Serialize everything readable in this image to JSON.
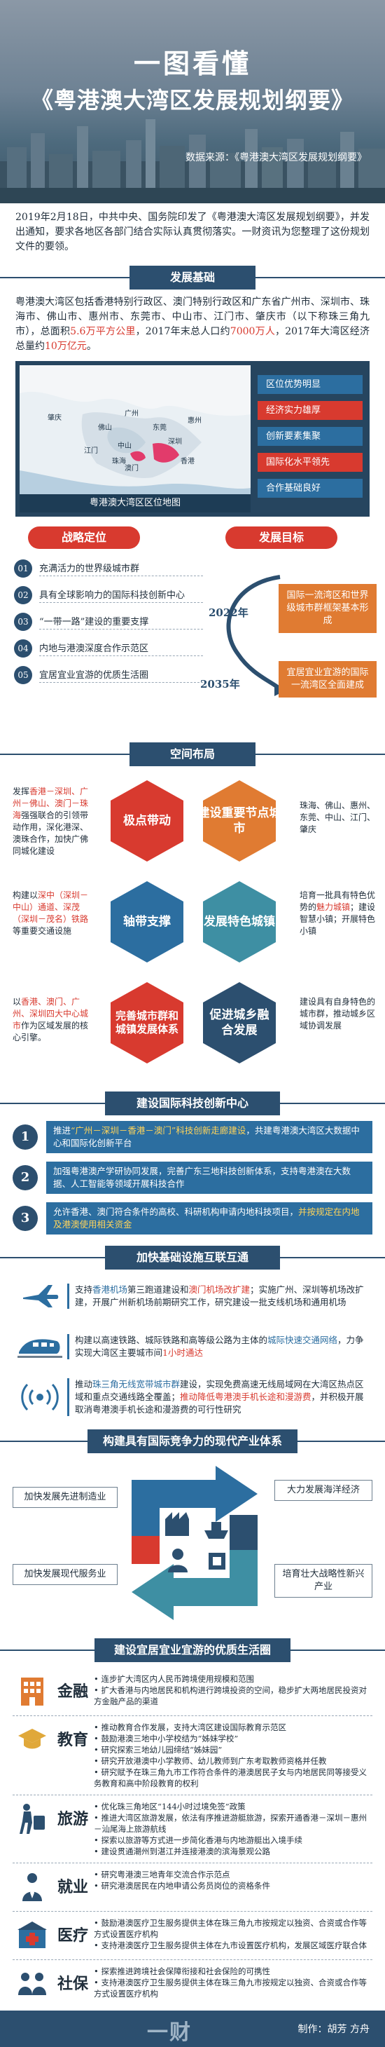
{
  "hero": {
    "kicker": "一图看懂",
    "title": "《粤港澳大湾区发展规划纲要》",
    "source": "数据来源：《粤港澳大湾区发展规划纲要》"
  },
  "intro": "2019年2月18日，中共中央、国务院印发了《粤港澳大湾区发展规划纲要》，并发出通知，要求各地区各部门结合实际认真贯彻落实。一财资讯为您整理了这份规划文件的要领。",
  "basics": {
    "header": "发展基础",
    "text_a": "粤港澳大湾区包括香港特别行政区、澳门特别行政区和广东省广州市、深圳市、珠海市、佛山市、惠州市、东莞市、中山市、江门市、肇庆市（以下称珠三角九市），总面积",
    "text_area": "5.6万平方公里",
    "text_b": "，2017年末总人口约",
    "text_pop": "7000万人",
    "text_c": "，2017年大湾区经济总量约",
    "text_gdp": "10万亿元",
    "text_d": "。",
    "map_caption": "粤港澳大湾区区位地图",
    "map_cities": [
      "广州",
      "佛山",
      "东莞",
      "惠州",
      "深圳",
      "香港",
      "澳门",
      "珠海",
      "中山",
      "江门",
      "肇庆"
    ],
    "advantages": [
      {
        "label": "区位优势明显",
        "color": "#2c6ea0"
      },
      {
        "label": "经济实力雄厚",
        "color": "#d83a2f"
      },
      {
        "label": "创新要素集聚",
        "color": "#2c6ea0"
      },
      {
        "label": "国际化水平领先",
        "color": "#d83a2f"
      },
      {
        "label": "合作基础良好",
        "color": "#2c6ea0"
      }
    ]
  },
  "positioning": {
    "header": "战略定位",
    "items": [
      {
        "num": "01",
        "text": "充满活力的世界级城市群"
      },
      {
        "num": "02",
        "text": "具有全球影响力的国际科技创新中心"
      },
      {
        "num": "03",
        "text": "“一带一路”建设的重要支撑"
      },
      {
        "num": "04",
        "text": "内地与港澳深度合作示范区"
      },
      {
        "num": "05",
        "text": "宜居宜业宜游的优质生活圈"
      }
    ]
  },
  "goals": {
    "header": "发展目标",
    "year_1": "2022年",
    "goal_1": "国际一流湾区和世界级城市群框架基本形成",
    "year_2": "2035年",
    "goal_2": "宜居宜业宜游的国际一流湾区全面建成"
  },
  "spatial": {
    "header": "空间布局",
    "hexes": [
      {
        "label": "极点带动",
        "color": "#d83a2f"
      },
      {
        "label": "建设重要节点城市",
        "color": "#e07b32"
      },
      {
        "label": "轴带支撑",
        "color": "#2c6ea0"
      },
      {
        "label": "发展特色城镇",
        "color": "#3e8fa3"
      },
      {
        "label": "完善城市群和城镇发展体系",
        "color": "#d83a2f"
      },
      {
        "label": "促进城乡融合发展",
        "color": "#2c4f6f"
      }
    ],
    "left_1_a": "发挥",
    "left_1_hl": "香港－深圳、广州－佛山、澳门－珠海",
    "left_1_b": "强强联合的引领带动作用，深化港深、澳珠合作，加快广佛同城化建设",
    "left_2_a": "构建以",
    "left_2_hl": "深中（深圳－中山）通道、深茂（深圳－茂名）铁路",
    "left_2_b": "等重要交通设施",
    "left_3_a": "以",
    "left_3_hl": "香港、澳门、广州、深圳四大中心城市",
    "left_3_b": "作为区域发展的核心引擎。",
    "right_1": "珠海、佛山、惠州、东莞、中山、江门、肇庆",
    "right_2_a": "培育一批具有特色优势的",
    "right_2_hl": "魅力城镇",
    "right_2_b": "；建设智慧小镇；开展特色小镇",
    "right_3": "建设具有自身特色的城市群，推动城乡区域协调发展"
  },
  "innovation": {
    "header": "建设国际科技创新中心",
    "rows": [
      {
        "num": "1",
        "a": "推进",
        "y": "“广州－深圳－香港－澳门”科技创新走廊建设",
        "b": "，共建粤港澳大湾区大数据中心和国际化创新平台"
      },
      {
        "num": "2",
        "a": "加强粤港澳产学研协同发展，完善广东三地科技创新体系，支持粤港澳在大数据、人工智能等领域开展科技合作",
        "y": "",
        "b": ""
      },
      {
        "num": "3",
        "a": "允许香港、澳门符合条件的高校、科研机构申请内地科技项目，",
        "y": "并按规定在内地及港澳使用相关资金",
        "b": ""
      }
    ]
  },
  "infrastructure": {
    "header": "加快基础设施互联互通",
    "rows": [
      {
        "icon": "airplane-icon",
        "a": "支持",
        "hl": "香港机场",
        "b": "第三跑道建设和",
        "rd": "澳门机场改扩建",
        "c": "；实施广州、深圳等机场改扩建，开展广州新机场前期研究工作，研究建设一批支线机场和通用机场"
      },
      {
        "icon": "train-icon",
        "a": "构建以高速铁路、城际铁路和高等级公路为主体的",
        "hl": "城际快速交通网络",
        "b": "，力争实现大湾区主要城市间",
        "rd": "1小时通达",
        "c": ""
      },
      {
        "icon": "signal-icon",
        "a": "推动",
        "hl": "珠三角无线宽带城市群",
        "b": "建设，实现免费高速无线局域网在大湾区热点区域和重点交通线路全覆盖；",
        "rd": "推动降低粤港澳手机长途和漫游费",
        "c": "，并积极开展取消粤港澳手机长途和漫游费的可行性研究"
      }
    ]
  },
  "industry": {
    "header": "构建具有国际竞争力的现代产业体系",
    "labels": [
      "加快发展先进制造业",
      "大力发展海洋经济",
      "加快发展现代服务业",
      "培育壮大战略性新兴产业"
    ]
  },
  "livable": {
    "header": "建设宜居宜业宜游的优质生活圈",
    "rows": [
      {
        "icon": "finance-icon",
        "cat": "金融",
        "items": [
          "连步扩大湾区内人民币跨境使用规模和范围",
          "扩大香港与内地居民和机构进行跨境投资的空间，稳步扩大两地居民投资对方金融产品的渠道"
        ]
      },
      {
        "icon": "education-icon",
        "cat": "教育",
        "items": [
          "推动教育合作发展，支持大湾区建设国际教育示范区",
          "鼓励港澳三地中小学校结为“姊妹学校”",
          "研究探索三地幼儿园缔结“姊妹园”",
          "研究开放港澳中小学教师、幼儿教师到广东考取教师资格并任教",
          "研究赋予在珠三角九市工作符合条件的港澳居民子女与内地居民同等接受义务教育和高中阶段教育的权利"
        ]
      },
      {
        "icon": "travel-icon",
        "cat": "旅游",
        "items": [
          "优化珠三角地区“144小时过境免签”政策",
          "推进大湾区旅游发展，依法有序推进游艇旅游，探索开通香港－深圳－惠州－汕尾海上旅游航线",
          "探索以旅游等方式进一步简化香港与内地游艇出入境手续",
          "建设贯通潮州到湛江并连接港澳的滨海景观公路"
        ]
      },
      {
        "icon": "employment-icon",
        "cat": "就业",
        "items": [
          "研究粤港澳三地青年交流合作示范点",
          "研究港澳居民在内地申请公务员岗位的资格条件"
        ]
      },
      {
        "icon": "medical-icon",
        "cat": "医疗",
        "items": [
          "鼓励港澳医疗卫生服务提供主体在珠三角九市按规定以独资、合资或合作等方式设置医疗机构",
          "支持港澳医疗卫生服务提供主体在九市设置医疗机构，发展区域医疗联合体"
        ]
      },
      {
        "icon": "social-security-icon",
        "cat": "社保",
        "items": [
          "探索推进跨境社会保障衔接和社会保险的可携性",
          "支持港澳医疗卫生服务提供主体在珠三角九市按规定以独资、合资或合作等方式设置医疗机构"
        ]
      }
    ]
  },
  "footer": {
    "logo": "一财",
    "maker": "制作：胡芳 方舟"
  },
  "colors": {
    "navy": "#2c4f6f",
    "blue": "#2c6ea0",
    "red": "#d83a2f",
    "orange": "#e07b32",
    "teal": "#3e8fa3"
  }
}
